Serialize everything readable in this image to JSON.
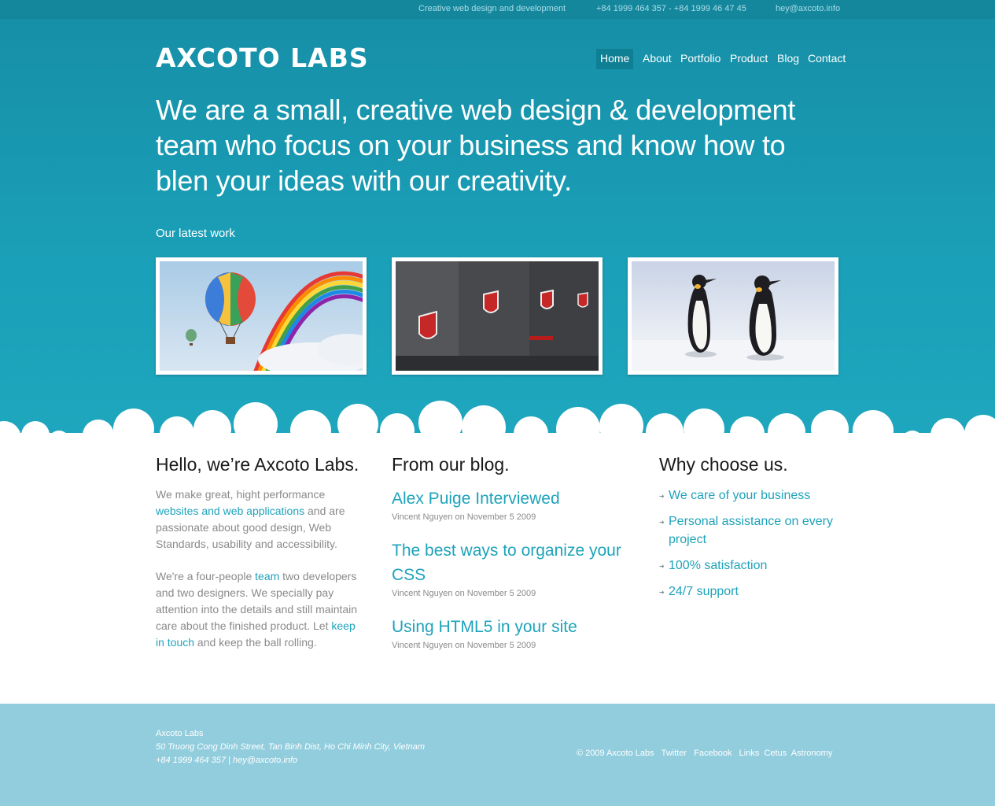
{
  "topbar": {
    "tagline": "Creative web design and development",
    "phones": "+84 1999 464 357 - +84 1999 46 47 45",
    "email": "hey@axcoto.info"
  },
  "brand": {
    "logo": "Axcoto Labs"
  },
  "nav": {
    "items": [
      "Home",
      "About",
      "Portfolio",
      "Product",
      "Blog",
      "Contact"
    ],
    "active": "Home"
  },
  "hero": {
    "headline": "We are a small, creative web design & development team who focus on your business and know how to blen your ideas with our creativity.",
    "latest_label": "Our latest work"
  },
  "about": {
    "title": "Hello, we’re Axcoto Labs.",
    "p1_before": "We make great, hight performance ",
    "p1_link": "websites and web applications",
    "p1_after": " and are passionate about good design, Web Standards, usability and accessibility.",
    "p2_before": "We're a four-people ",
    "p2_link1": "team",
    "p2_mid": " two developers and two designers. We specially pay attention into the details and still maintain care about the finished product. Let ",
    "p2_link2": "keep in touch",
    "p2_after": " and keep the ball rolling."
  },
  "blog": {
    "title": "From our blog.",
    "posts": [
      {
        "title": "Alex Puige Interviewed",
        "meta": "Vincent Nguyen on November 5 2009"
      },
      {
        "title": "The best ways to organize your CSS",
        "meta": "Vincent Nguyen on November 5 2009"
      },
      {
        "title": "Using HTML5 in your site",
        "meta": "Vincent Nguyen on November 5 2009"
      }
    ]
  },
  "why": {
    "title": "Why choose us.",
    "items": [
      "We care of your business",
      "Personal assistance on every project",
      "100% satisfaction",
      "24/7 support"
    ]
  },
  "footer": {
    "company": "Axcoto Labs",
    "address": "50 Truong Cong Dinh Street, Tan Binh Dist, Ho Chi Minh City, Vietnam",
    "contact": "+84 1999 464 357 | hey@axcoto.info",
    "copyright": "© 2009 Axcoto Labs",
    "links": [
      "Twitter",
      "Facebook",
      "Links",
      "Cetus",
      "Astronomy"
    ]
  },
  "colors": {
    "accent": "#1ea3bb",
    "hero": "#1aa0b8",
    "footer": "#92cddd"
  }
}
